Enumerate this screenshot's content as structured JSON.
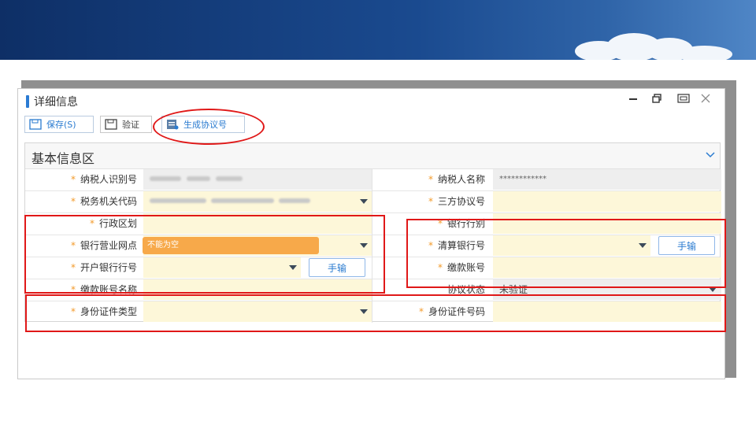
{
  "window": {
    "title": "详细信息",
    "controls": [
      "minimize-icon",
      "restore-icon",
      "maximize-icon",
      "close-icon"
    ]
  },
  "toolbar": {
    "save_label": "保存(S)",
    "verify_label": "验证",
    "generate_label": "生成协议号"
  },
  "section": {
    "title": "基本信息区"
  },
  "fields": {
    "taxpayer_id": {
      "label": "纳税人识别号"
    },
    "taxpayer_name": {
      "label": "纳税人名称",
      "value": "************"
    },
    "tax_authority_code": {
      "label": "税务机关代码"
    },
    "tripartite_no": {
      "label": "三方协议号"
    },
    "admin_region": {
      "label": "行政区划"
    },
    "bank_type": {
      "label": "银行行别"
    },
    "bank_branch": {
      "label": "银行营业网点"
    },
    "clearing_bank_no": {
      "label": "清算银行号"
    },
    "opening_bank_no": {
      "label": "开户银行行号"
    },
    "payment_account": {
      "label": "缴款账号"
    },
    "payment_account_name": {
      "label": "缴款账号名称"
    },
    "agreement_status": {
      "label": "协议状态",
      "value": "未验证"
    },
    "id_type": {
      "label": "身份证件类型"
    },
    "id_number": {
      "label": "身份证件号码"
    }
  },
  "buttons": {
    "manual_label": "手输"
  },
  "validation": {
    "tooltip": "不能为空"
  },
  "colors": {
    "accent": "#2b7bd3",
    "required_star": "#f39a2b",
    "field_bg": "#fdf7d9",
    "annotation_red": "#e01818",
    "tooltip_bg": "#f7a94a"
  }
}
